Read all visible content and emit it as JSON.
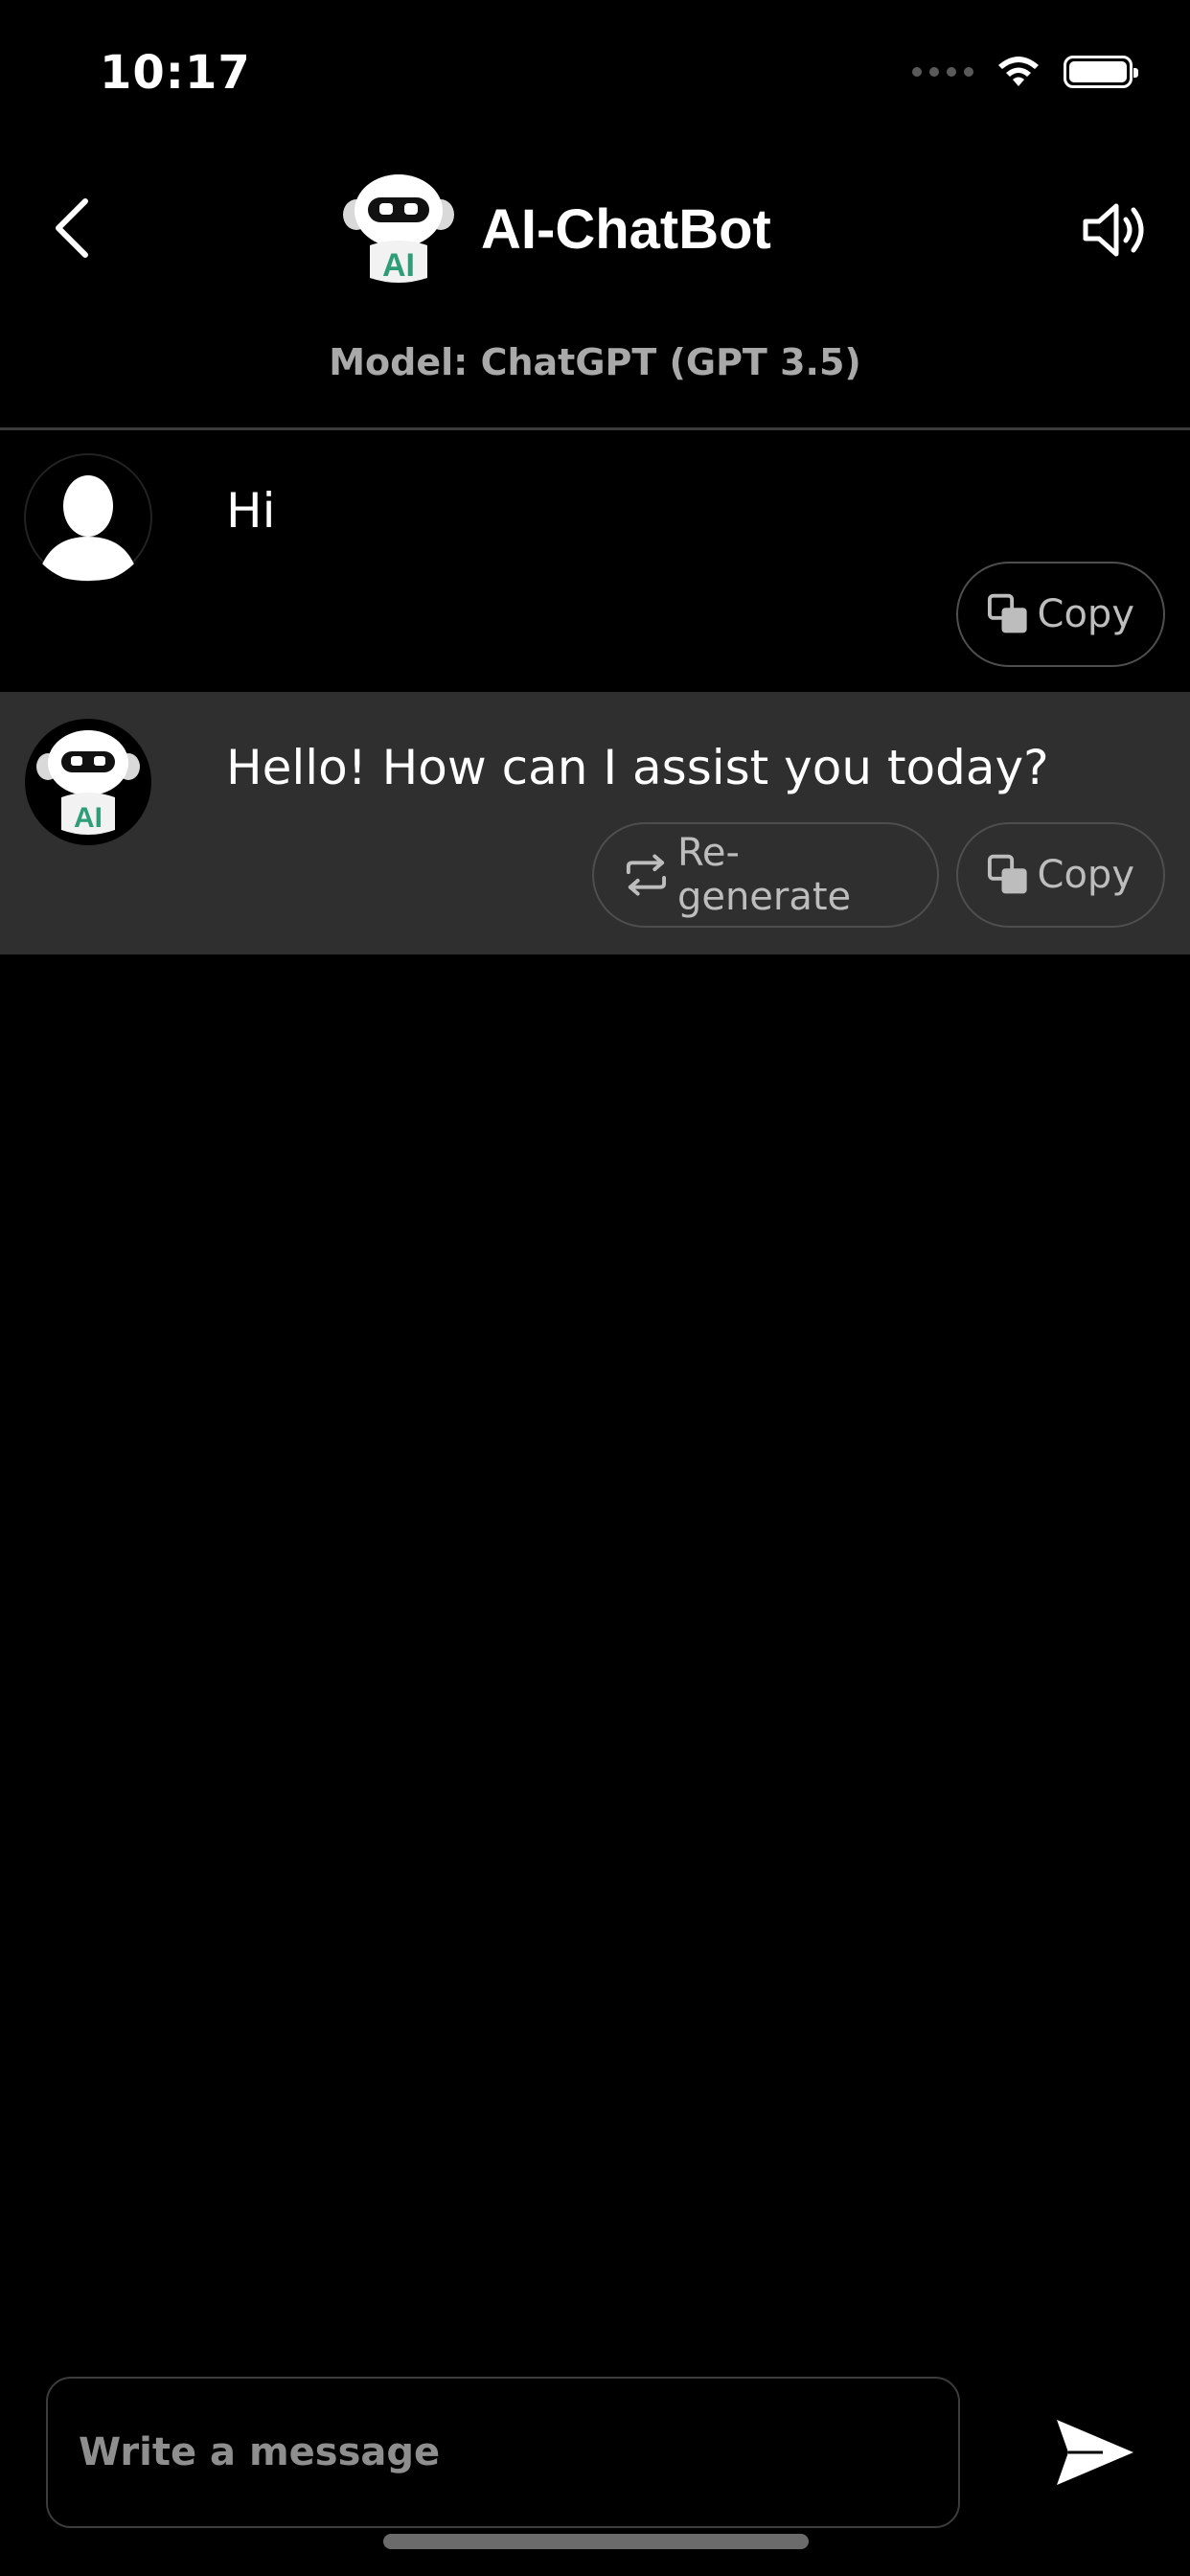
{
  "status_bar": {
    "time": "10:17"
  },
  "header": {
    "title": "AI-ChatBot",
    "model_label": "Model: ChatGPT (GPT 3.5)",
    "icons": {
      "back": "chevron-left-icon",
      "speaker": "speaker-icon",
      "logo": "robot-logo-icon"
    }
  },
  "messages": [
    {
      "role": "user",
      "text": "Hi",
      "actions": {
        "copy": "Copy"
      }
    },
    {
      "role": "bot",
      "text": "Hello! How can I assist you today?",
      "actions": {
        "regenerate": "Re-generate",
        "copy": "Copy"
      }
    }
  ],
  "composer": {
    "placeholder": "Write a message",
    "value": ""
  },
  "colors": {
    "background": "#000000",
    "bot_row": "#2f2f2f",
    "muted_text": "#a9a9a9",
    "ai_green": "#2f9e78"
  }
}
